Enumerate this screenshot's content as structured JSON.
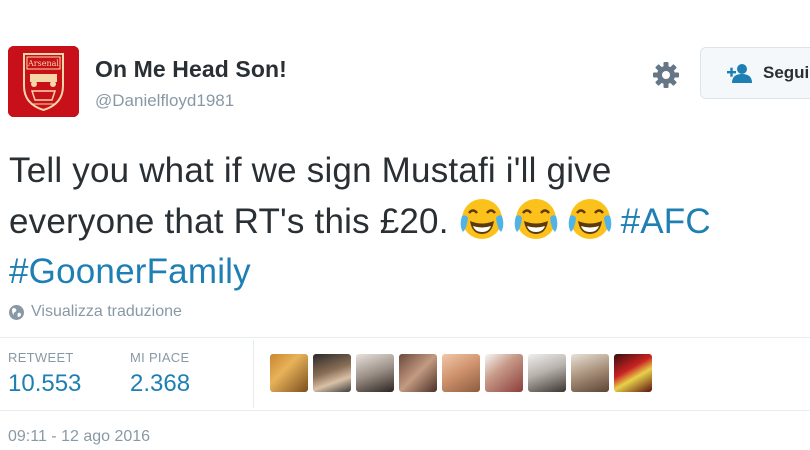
{
  "user": {
    "name": "On Me Head Son!",
    "handle": "@Danielfloyd1981",
    "avatar_logo_text": "Arsenal"
  },
  "header": {
    "settings_icon": "gear-icon",
    "follow_label": "Segui",
    "follow_icon": "add-user-icon"
  },
  "tweet": {
    "line1": "Tell you what if we sign Mustafi i'll give",
    "line2_text": "everyone that RT's this £20.",
    "emoji": [
      "face-with-tears-of-joy",
      "face-with-tears-of-joy",
      "face-with-tears-of-joy"
    ],
    "hashtags": [
      "#AFC",
      "#GoonerFamily"
    ]
  },
  "translate": {
    "label": "Visualizza traduzione",
    "icon": "globe-icon"
  },
  "stats": {
    "retweet_label": "RETWEET",
    "retweet_value": "10.553",
    "likes_label": "MI PIACE",
    "likes_value": "2.368"
  },
  "liker_avatars_count": 9,
  "timestamp": "09:11 - 12 ago 2016",
  "colors": {
    "link": "#1d7fb3",
    "muted": "#8899a6",
    "text": "#292f33",
    "avatar_bg": "#c8101b"
  }
}
